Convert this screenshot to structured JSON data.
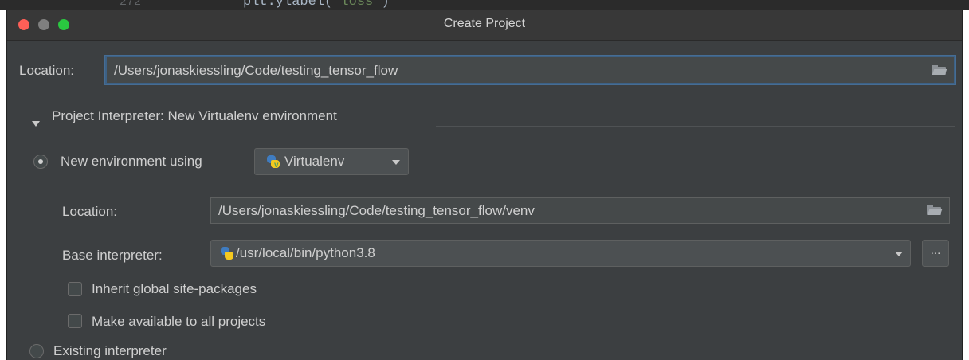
{
  "background_code": {
    "line_number": "272",
    "code_text": "plt.ylabel(",
    "code_string": "'loss'",
    "code_close": ")"
  },
  "window": {
    "title": "Create Project"
  },
  "project_location": {
    "label": "Location:",
    "value": "/Users/jonaskiessling/Code/testing_tensor_flow"
  },
  "interpreter_section": {
    "title": "Project Interpreter: New Virtualenv environment",
    "expanded": true
  },
  "new_environment": {
    "radio_label": "New environment using",
    "selected": true,
    "tool": "Virtualenv",
    "tool_icon": "python-virtualenv-icon",
    "location_label": "Location:",
    "location_value": "/Users/jonaskiessling/Code/testing_tensor_flow/venv",
    "base_label": "Base interpreter:",
    "base_value": "/usr/local/bin/python3.8",
    "base_icon": "python-icon",
    "more_label": "...",
    "inherit_label": "Inherit global site-packages",
    "inherit_checked": false,
    "available_label": "Make available to all projects",
    "available_checked": false
  },
  "existing_interpreter": {
    "radio_label": "Existing interpreter",
    "selected": false
  },
  "colors": {
    "dialog_bg": "#3c3f41",
    "field_bg": "#45494a",
    "focus_border": "#3d6185",
    "close": "#fe5f57",
    "zoom": "#2ac840"
  }
}
